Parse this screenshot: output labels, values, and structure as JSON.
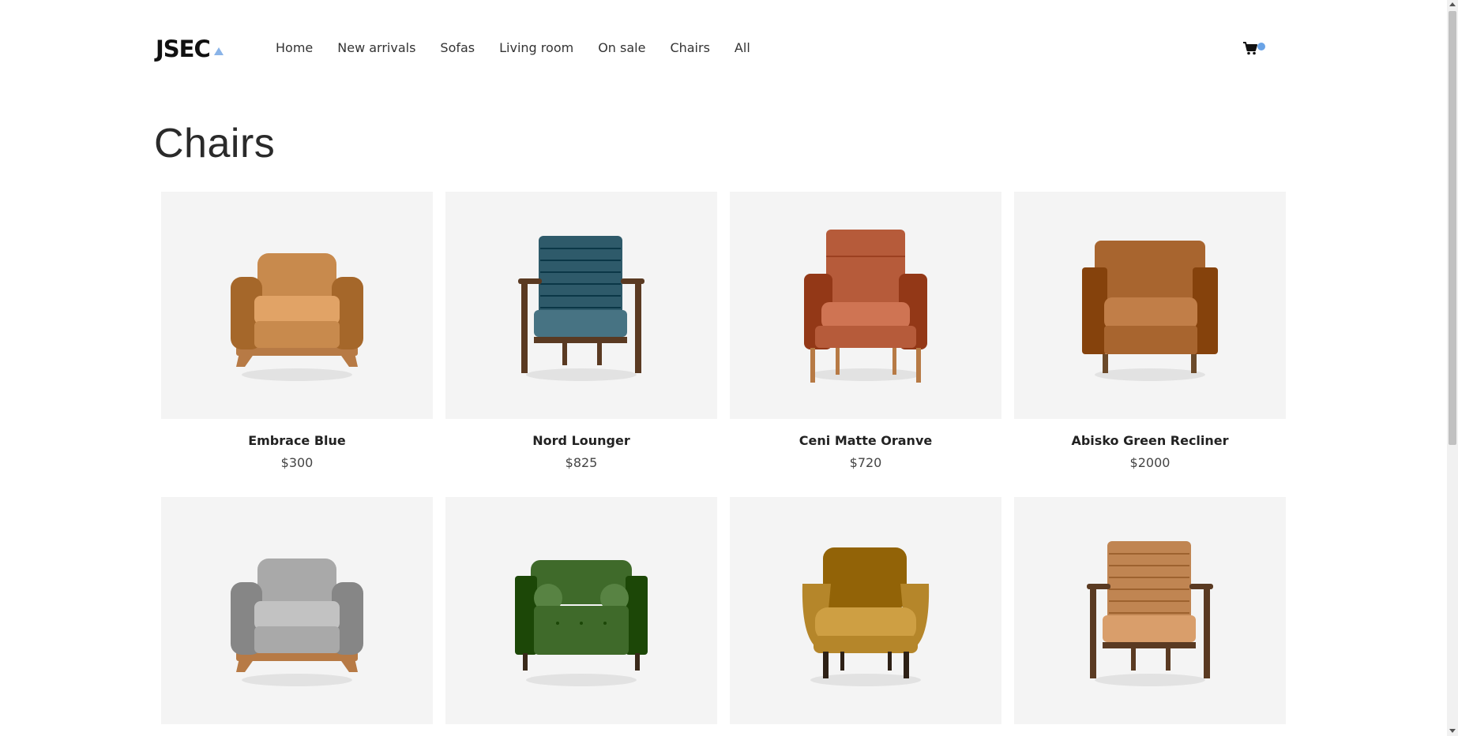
{
  "brand": {
    "logo_text": "JSEC"
  },
  "nav": {
    "items": [
      "Home",
      "New arrivals",
      "Sofas",
      "Living room",
      "On sale",
      "Chairs",
      "All"
    ]
  },
  "page": {
    "title": "Chairs"
  },
  "products": [
    {
      "name": "Embrace Blue",
      "price": "$300",
      "color": "#c88a4d",
      "style": "armchair-leather"
    },
    {
      "name": "Nord Lounger",
      "price": "$825",
      "color": "#2e5a6a",
      "style": "lounger-wood"
    },
    {
      "name": "Ceni Matte Oranve",
      "price": "$720",
      "color": "#b65b3a",
      "style": "club-leather"
    },
    {
      "name": "Abisko Green Recliner",
      "price": "$2000",
      "color": "#a8652f",
      "style": "box-leather"
    },
    {
      "name": "",
      "price": "",
      "color": "#a9a9a9",
      "style": "armchair-fabric"
    },
    {
      "name": "",
      "price": "",
      "color": "#3f6a2a",
      "style": "velvet-bolster"
    },
    {
      "name": "",
      "price": "",
      "color": "#b5862a",
      "style": "velvet-round"
    },
    {
      "name": "",
      "price": "",
      "color": "#c08552",
      "style": "lounger-wood"
    }
  ],
  "icons": {
    "cart": "cart-icon",
    "notification": "cart-dot",
    "logo_mark": "triangle-icon"
  }
}
